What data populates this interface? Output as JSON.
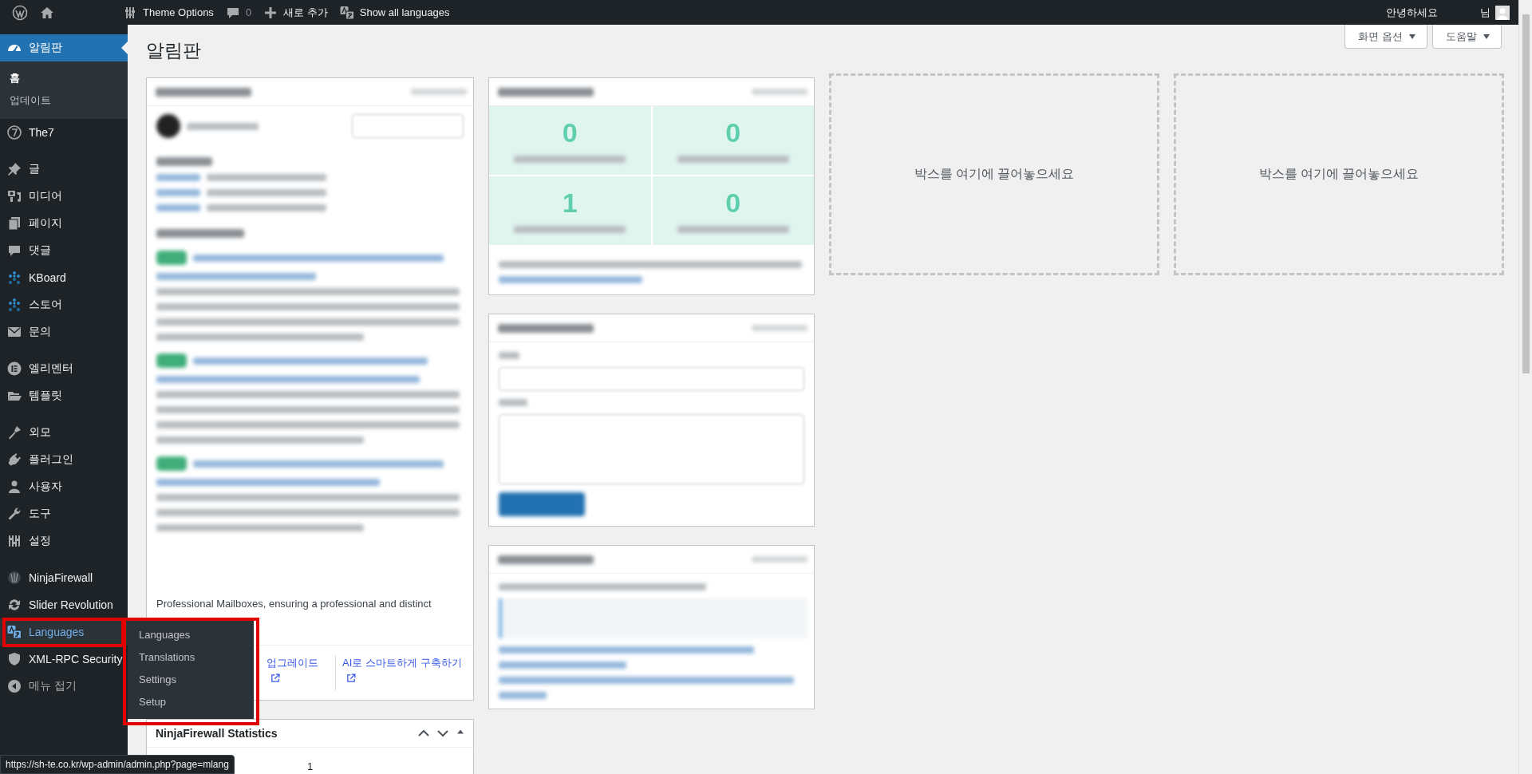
{
  "admin_bar": {
    "items": [
      {
        "kind": "wp-logo"
      },
      {
        "kind": "home"
      },
      {
        "kind": "theme-options",
        "label": "Theme Options"
      },
      {
        "kind": "comments",
        "label": "0"
      },
      {
        "kind": "new",
        "label": "새로 추가"
      },
      {
        "kind": "languages",
        "label": "Show all languages"
      }
    ],
    "greeting": "안녕하세요",
    "account": "님"
  },
  "sidebar": {
    "groups": [
      [
        {
          "label": "알림판",
          "selected": true,
          "hovered": false,
          "framed": false,
          "children": [
            {
              "label": "홈",
              "selected": true
            },
            {
              "label": "업데이트",
              "selected": false
            }
          ]
        },
        {
          "label": "The7",
          "selected": false,
          "hovered": false,
          "framed": false
        }
      ],
      [
        {
          "label": "글",
          "selected": false,
          "hovered": false,
          "framed": false
        },
        {
          "label": "미디어",
          "selected": false,
          "hovered": false,
          "framed": false
        },
        {
          "label": "페이지",
          "selected": false,
          "hovered": false,
          "framed": false
        },
        {
          "label": "댓글",
          "selected": false,
          "hovered": false,
          "framed": false
        },
        {
          "label": "KBoard",
          "selected": false,
          "hovered": false,
          "framed": false
        },
        {
          "label": "스토어",
          "selected": false,
          "hovered": false,
          "framed": false
        },
        {
          "label": "문의",
          "selected": false,
          "hovered": false,
          "framed": false
        }
      ],
      [
        {
          "label": "엘리멘터",
          "selected": false,
          "hovered": false,
          "framed": false
        },
        {
          "label": "템플릿",
          "selected": false,
          "hovered": false,
          "framed": false
        }
      ],
      [
        {
          "label": "외모",
          "selected": false,
          "hovered": false,
          "framed": false
        },
        {
          "label": "플러그인",
          "selected": false,
          "hovered": false,
          "framed": false
        },
        {
          "label": "사용자",
          "selected": false,
          "hovered": false,
          "framed": false
        },
        {
          "label": "도구",
          "selected": false,
          "hovered": false,
          "framed": false
        },
        {
          "label": "설정",
          "selected": false,
          "hovered": false,
          "framed": false
        }
      ],
      [
        {
          "label": "NinjaFirewall",
          "selected": false,
          "hovered": false,
          "framed": false
        },
        {
          "label": "Slider Revolution",
          "selected": false,
          "hovered": false,
          "framed": false
        },
        {
          "label": "Languages",
          "selected": false,
          "hovered": true,
          "framed": true,
          "flyout": [
            "Languages",
            "Translations",
            "Settings",
            "Setup"
          ]
        },
        {
          "label": "XML-RPC Security",
          "selected": false,
          "hovered": false,
          "framed": false
        }
      ]
    ],
    "collapse_label": "메뉴 접기"
  },
  "main": {
    "title": "알림판",
    "screen_buttons": [
      "화면 옵션",
      "도움말"
    ],
    "columns": [
      [
        {
          "kind": "activity",
          "visible_text": "Professional Mailboxes, ensuring a professional and distinct",
          "footer_links": [
            "업그레이드",
            "AI로 스마트하게 구축하기"
          ]
        },
        {
          "kind": "statistics",
          "title": "NinjaFirewall Statistics",
          "value": "1"
        }
      ],
      [
        {
          "kind": "login-lockdown",
          "stats": [
            "0",
            "0",
            "1",
            "0"
          ]
        },
        {
          "kind": "quick-draft"
        },
        {
          "kind": "events"
        }
      ]
    ],
    "drop_zones": [
      "박스를 여기에 끌어놓으세요",
      "박스를 여기에 끌어놓으세요"
    ]
  },
  "status_url": "https://sh-te.co.kr/wp-admin/admin.php?page=mlang"
}
